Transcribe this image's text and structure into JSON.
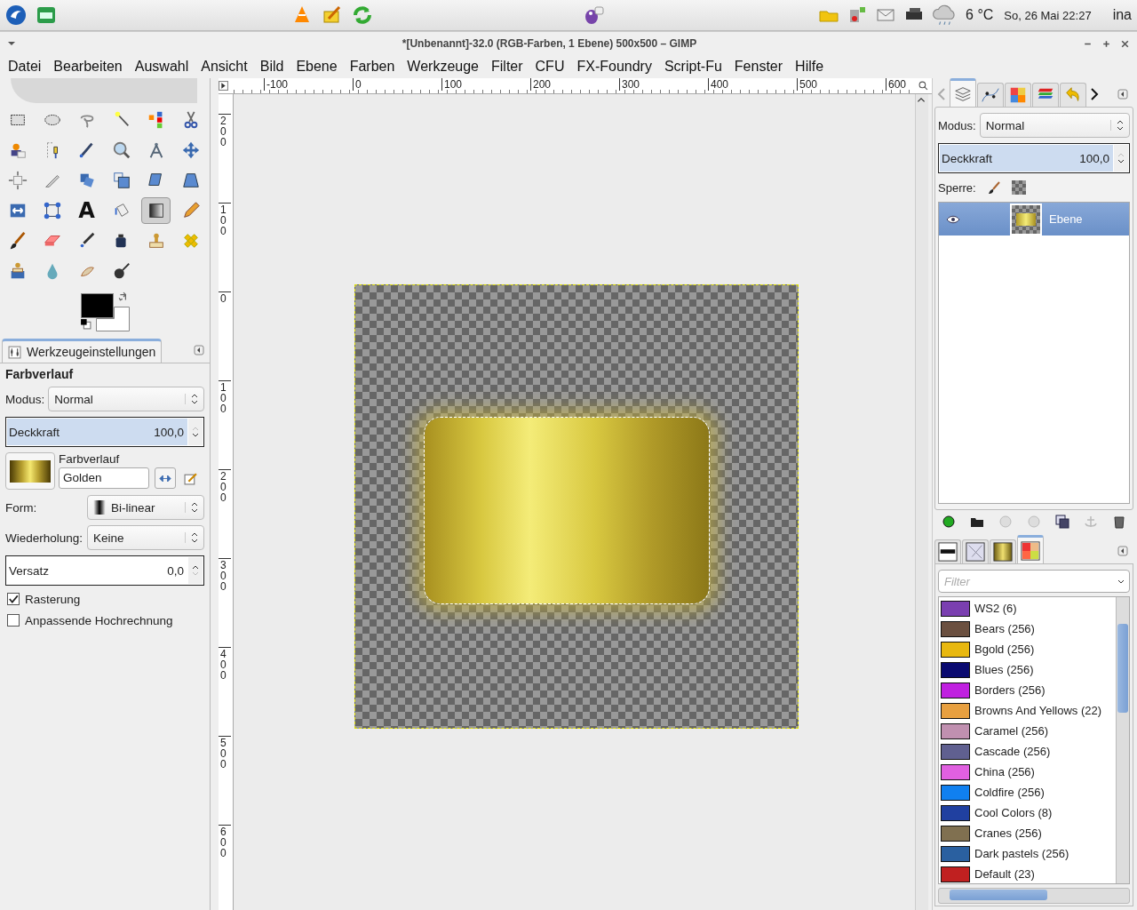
{
  "top_panel": {
    "temperature": "6 °C",
    "datetime": "So, 26 Mai 22:27",
    "user": "ina"
  },
  "window": {
    "title": "*[Unbenannt]-32.0 (RGB-Farben, 1 Ebene) 500x500 – GIMP"
  },
  "menu": [
    "Datei",
    "Bearbeiten",
    "Auswahl",
    "Ansicht",
    "Bild",
    "Ebene",
    "Farben",
    "Werkzeuge",
    "Filter",
    "CFU",
    "FX-Foundry",
    "Script-Fu",
    "Fenster",
    "Hilfe"
  ],
  "toolbox": {
    "tools": [
      {
        "selected": false
      },
      {
        "selected": false
      },
      {
        "selected": false
      },
      {
        "selected": false
      },
      {
        "selected": false
      },
      {
        "selected": false
      },
      {
        "selected": false
      },
      {
        "selected": false
      },
      {
        "selected": false
      },
      {
        "selected": false
      },
      {
        "selected": false
      },
      {
        "selected": false
      },
      {
        "selected": false
      },
      {
        "selected": false
      },
      {
        "selected": false
      },
      {
        "selected": false
      },
      {
        "selected": false
      },
      {
        "selected": false
      },
      {
        "selected": false
      },
      {
        "selected": false
      },
      {
        "selected": false,
        "glyph": "A"
      },
      {
        "selected": false
      },
      {
        "selected": true
      },
      {
        "selected": false
      },
      {
        "selected": false
      },
      {
        "selected": false
      },
      {
        "selected": false
      },
      {
        "selected": false
      },
      {
        "selected": false
      },
      {
        "selected": false
      },
      {
        "selected": false
      },
      {
        "selected": false
      },
      {
        "selected": false
      },
      {
        "selected": false
      }
    ]
  },
  "tool_options": {
    "tab": "Werkzeugeinstellungen",
    "title": "Farbverlauf",
    "mode": {
      "label": "Modus:",
      "value": "Normal"
    },
    "opacity": {
      "label": "Deckkraft",
      "reading": "100,0",
      "level": 1
    },
    "gradient": {
      "label": "Farbverlauf",
      "value": "Golden"
    },
    "shape": {
      "label": "Form:",
      "value": "Bi-linear"
    },
    "repeat": {
      "label": "Wiederholung:",
      "value": "Keine"
    },
    "offset": {
      "label": "Versatz",
      "reading": "0,0",
      "level": 0
    },
    "checkboxes": [
      {
        "label": "Rasterung",
        "checked": true
      },
      {
        "label": "Anpassende Hochrechnung",
        "checked": false
      }
    ]
  },
  "rulers": {
    "horizontal": [
      "-100",
      "0",
      "100",
      "200",
      "300",
      "400",
      "500",
      "600"
    ],
    "vertical": [
      "200",
      "100",
      "0",
      "100",
      "200",
      "300",
      "400",
      "500",
      "600"
    ]
  },
  "layers_panel": {
    "mode": {
      "label": "Modus:",
      "value": "Normal"
    },
    "opacity": {
      "label": "Deckkraft",
      "reading": "100,0",
      "level": 1
    },
    "lock_label": "Sperre:",
    "layers": [
      {
        "name": "Ebene",
        "visible": true,
        "selected": true
      }
    ]
  },
  "palettes_panel": {
    "filter": {
      "placeholder": "Filter"
    },
    "palettes": [
      {
        "name": "WS2 (6)",
        "color": "#7a3fb0"
      },
      {
        "name": "Bears (256)",
        "color": "#6b5040"
      },
      {
        "name": "Bgold (256)",
        "color": "#e8b810"
      },
      {
        "name": "Blues (256)",
        "color": "#0a0a70"
      },
      {
        "name": "Borders (256)",
        "color": "#c020e0"
      },
      {
        "name": "Browns And Yellows (22)",
        "color": "#e8a040"
      },
      {
        "name": "Caramel (256)",
        "color": "#c090b0"
      },
      {
        "name": "Cascade (256)",
        "color": "#606090"
      },
      {
        "name": "China (256)",
        "color": "#e060e0"
      },
      {
        "name": "Coldfire (256)",
        "color": "#1080f0"
      },
      {
        "name": "Cool Colors (8)",
        "color": "#2040a0"
      },
      {
        "name": "Cranes (256)",
        "color": "#807050"
      },
      {
        "name": "Dark pastels (256)",
        "color": "#2a60a0"
      },
      {
        "name": "Default (23)",
        "color": "#c02020"
      }
    ]
  }
}
